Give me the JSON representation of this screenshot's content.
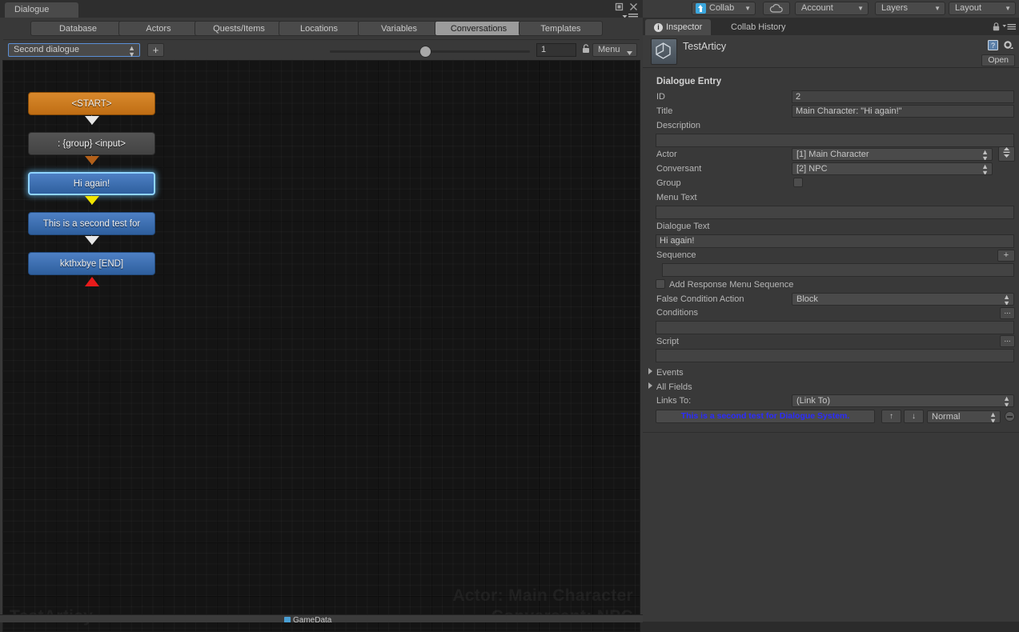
{
  "window": {
    "tab_label": "Dialogue",
    "controls": {
      "maximize": "maximize-icon",
      "close": "close-icon",
      "menu": "panel-menu-icon"
    }
  },
  "database_tabs": [
    {
      "label": "Database",
      "active": false
    },
    {
      "label": "Actors",
      "active": false
    },
    {
      "label": "Quests/Items",
      "active": false
    },
    {
      "label": "Locations",
      "active": false
    },
    {
      "label": "Variables",
      "active": false
    },
    {
      "label": "Conversations",
      "active": true
    },
    {
      "label": "Templates",
      "active": false
    }
  ],
  "toolbar": {
    "conversation_selected": "Second dialogue",
    "add_label": "+",
    "zoom_value": "1",
    "zoom_percent": 45,
    "lock_icon": "lock-icon",
    "menu_label": "Menu"
  },
  "canvas": {
    "nodes": [
      {
        "label": "<START>",
        "type": "start",
        "selected": false
      },
      {
        "label": ": {group} <input>",
        "type": "group",
        "selected": false
      },
      {
        "label": "Hi again!",
        "type": "dialogue",
        "selected": true
      },
      {
        "label": "This is a second test for",
        "type": "dialogue",
        "selected": false
      },
      {
        "label": "kkthxbye [END]",
        "type": "dialogue",
        "selected": false
      }
    ],
    "watermark_left": "TestArticy",
    "watermark_actor": "Actor: Main Character",
    "watermark_conversant": "Conversant: NPC"
  },
  "hierarchy": {
    "item": "GameData"
  },
  "top_toolbar": {
    "collab_label": "Collab",
    "cloud_icon": "cloud-icon",
    "account_label": "Account",
    "layers_label": "Layers",
    "layout_label": "Layout"
  },
  "inspector": {
    "tabs": [
      {
        "label": "Inspector",
        "active": true
      },
      {
        "label": "Collab History",
        "active": false
      }
    ],
    "lock_icon": "lock-icon",
    "menu_icon": "hamburger-menu-icon",
    "asset_name": "TestArticy",
    "help_icon": "help-book-icon",
    "gear_icon": "gear-icon",
    "open_label": "Open",
    "section_title": "Dialogue Entry",
    "fields": {
      "id_label": "ID",
      "id_value": "2",
      "title_label": "Title",
      "title_value": "Main Character: \"Hi again!\"",
      "description_label": "Description",
      "description_value": "",
      "actor_label": "Actor",
      "actor_value": "[1] Main Character",
      "swap_icon": "swap-arrows-icon",
      "conversant_label": "Conversant",
      "conversant_value": "[2] NPC",
      "group_label": "Group",
      "group_checked": false,
      "menu_text_label": "Menu Text",
      "menu_text_value": "",
      "dialogue_text_label": "Dialogue Text",
      "dialogue_text_value": "Hi again!",
      "sequence_label": "Sequence",
      "sequence_add": "+",
      "sequence_value": "",
      "add_response_label": "Add Response Menu Sequence",
      "add_response_checked": false,
      "false_condition_label": "False Condition Action",
      "false_condition_value": "Block",
      "conditions_label": "Conditions",
      "conditions_more": "...",
      "conditions_value": "",
      "script_label": "Script",
      "script_more": "...",
      "script_value": "",
      "events_label": "Events",
      "all_fields_label": "All Fields",
      "links_to_label": "Links To:",
      "links_to_value": "(Link To)"
    },
    "links": [
      {
        "label": "This is a second test for Dialogue System.",
        "up": "↑",
        "down": "↓",
        "priority": "Normal",
        "remove": "remove-link-icon"
      }
    ]
  }
}
